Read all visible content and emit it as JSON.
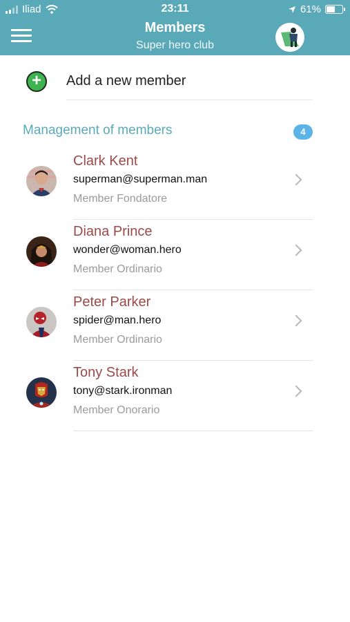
{
  "status_bar": {
    "carrier": "Iliad",
    "time": "23:11",
    "battery": "61%",
    "battery_level": 0.61
  },
  "header": {
    "title": "Members",
    "subtitle": "Super hero club"
  },
  "add_member": {
    "label": "Add a new member"
  },
  "section": {
    "title": "Management of members",
    "count": "4"
  },
  "members": [
    {
      "name": "Clark Kent",
      "email": "superman@superman.man",
      "role": "Member Fondatore"
    },
    {
      "name": "Diana Prince",
      "email": "wonder@woman.hero",
      "role": "Member Ordinario"
    },
    {
      "name": "Peter Parker",
      "email": "spider@man.hero",
      "role": "Member Ordinario"
    },
    {
      "name": "Tony Stark",
      "email": "tony@stark.ironman",
      "role": "Member Onorario"
    }
  ],
  "colors": {
    "header": "#5aa9b8",
    "accent": "#5aa9b8",
    "badge": "#5bb3e7",
    "name": "#9b4a48",
    "add": "#3fb34f"
  }
}
